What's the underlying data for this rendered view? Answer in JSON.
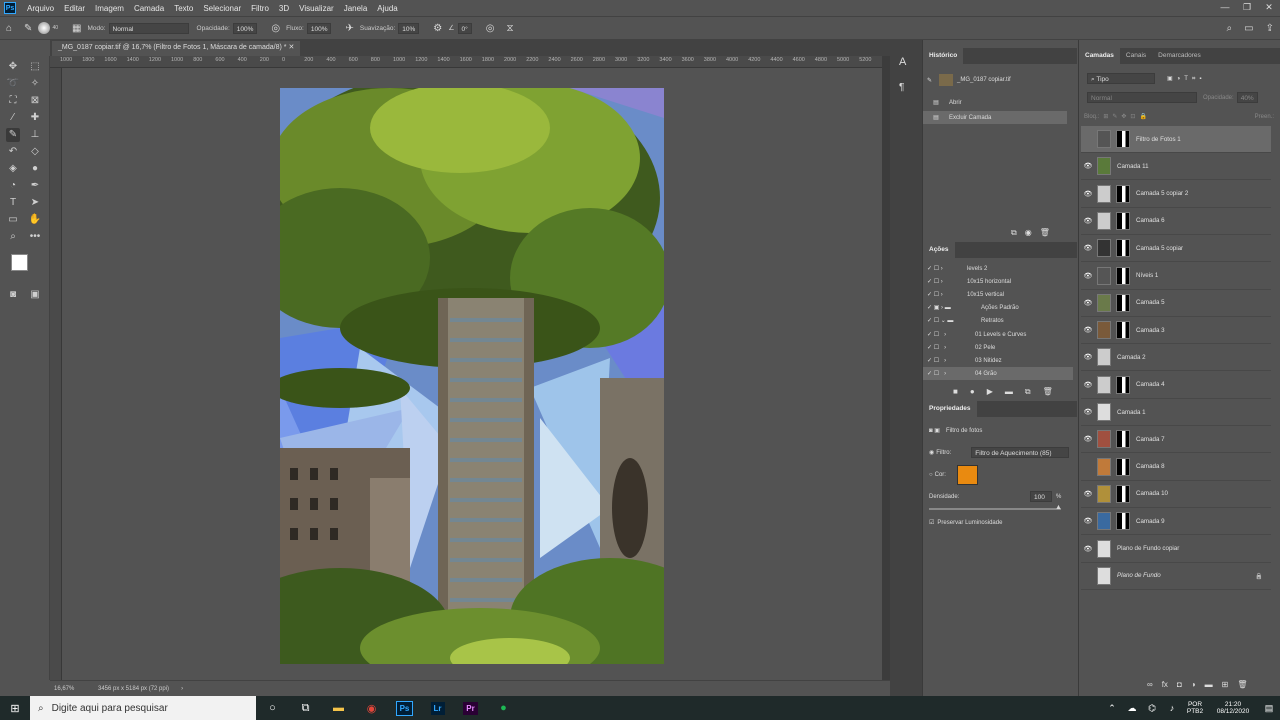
{
  "menubar": {
    "logo": "Ps",
    "items": [
      "Arquivo",
      "Editar",
      "Imagem",
      "Camada",
      "Texto",
      "Selecionar",
      "Filtro",
      "3D",
      "Visualizar",
      "Janela",
      "Ajuda"
    ],
    "win_controls": [
      "—",
      "❐",
      "✕"
    ]
  },
  "options": {
    "brush_size": "40",
    "mode_label": "Modo:",
    "mode_value": "Normal",
    "opacity_label": "Opacidade:",
    "opacity_value": "100%",
    "flow_label": "Fluxo:",
    "flow_value": "100%",
    "smoothing_label": "Suavização:",
    "smoothing_value": "10%",
    "angle_value": "0°"
  },
  "document": {
    "tab_title": "_MG_0187 copiar.tif @ 16,7% (Filtro de Fotos 1, Máscara de camada/8) *",
    "zoom": "16,67%",
    "dimensions": "3456 px x 5184 px (72 ppi)",
    "ruler_labels": [
      "1000",
      "1800",
      "1600",
      "1400",
      "1200",
      "1000",
      "800",
      "600",
      "400",
      "200",
      "0",
      "200",
      "400",
      "600",
      "800",
      "1000",
      "1200",
      "1400",
      "1600",
      "1800",
      "2000",
      "2200",
      "2400",
      "2600",
      "2800",
      "3000",
      "3200",
      "3400",
      "3600",
      "3800",
      "4000",
      "4200",
      "4400",
      "4600",
      "4800",
      "5000",
      "5200"
    ]
  },
  "history": {
    "title": "Histórico",
    "snapshot": "_MG_0187 copiar.tif",
    "items": [
      "Abrir",
      "Excluir Camada"
    ]
  },
  "actions": {
    "title": "Ações",
    "items": [
      "levels 2",
      "10x15 horizontal",
      "10x15 vertical",
      "Ações Padrão",
      "Retratos",
      "01 Levels e Curves",
      "02 Pele",
      "03 Nitidez",
      "04 Grão"
    ]
  },
  "properties": {
    "title": "Propriedades",
    "subtitle": "Filtro de fotos",
    "filter_label": "Filtro:",
    "filter_value": "Filtro de Aquecimento (85)",
    "color_label": "Cor:",
    "color_hex": "#e98a10",
    "density_label": "Densidade:",
    "density_value": "100",
    "density_unit": "%",
    "preserve_label": "Preservar Luminosidade"
  },
  "layers_panel": {
    "tabs": [
      "Camadas",
      "Canais",
      "Demarcadores"
    ],
    "kind_filter": "Tipo",
    "blend_mode": "Normal",
    "opacity_label": "Opacidade:",
    "opacity_value": "40%",
    "lock_label": "Bloq.:",
    "fill_label": "Preen.:",
    "layers": [
      {
        "name": "Filtro de Fotos 1",
        "visible": false,
        "thumb": "#555",
        "mask": true,
        "selected": true
      },
      {
        "name": "Camada 11",
        "visible": true,
        "thumb": "#5a7a3a",
        "mask": false
      },
      {
        "name": "Camada 5 copiar 2",
        "visible": true,
        "thumb": "#ccc",
        "mask": true
      },
      {
        "name": "Camada 6",
        "visible": true,
        "thumb": "#ccc",
        "mask": true
      },
      {
        "name": "Camada 5 copiar",
        "visible": true,
        "thumb": "#333",
        "mask": true
      },
      {
        "name": "Níveis 1",
        "visible": true,
        "thumb": "#555",
        "mask": true
      },
      {
        "name": "Camada 5",
        "visible": true,
        "thumb": "#6a7a4a",
        "mask": true
      },
      {
        "name": "Camada 3",
        "visible": true,
        "thumb": "#7a5a3a",
        "mask": true
      },
      {
        "name": "Camada 2",
        "visible": true,
        "thumb": "#ccc",
        "mask": false
      },
      {
        "name": "Camada 4",
        "visible": true,
        "thumb": "#ccc",
        "mask": true
      },
      {
        "name": "Camada 1",
        "visible": true,
        "thumb": "#ddd",
        "mask": false
      },
      {
        "name": "Camada 7",
        "visible": true,
        "thumb": "#a05040",
        "mask": true
      },
      {
        "name": "Camada 8",
        "visible": false,
        "thumb": "#c07a3a",
        "mask": true
      },
      {
        "name": "Camada 10",
        "visible": true,
        "thumb": "#b0903a",
        "mask": true
      },
      {
        "name": "Camada 9",
        "visible": true,
        "thumb": "#3a6aa0",
        "mask": true
      },
      {
        "name": "Plano de Fundo copiar",
        "visible": true,
        "thumb": "#ddd",
        "mask": false
      },
      {
        "name": "Plano de Fundo",
        "visible": false,
        "thumb": "#ddd",
        "mask": false,
        "locked": true
      }
    ]
  },
  "taskbar": {
    "search_placeholder": "Digite aqui para pesquisar",
    "lang": "POR",
    "lang2": "PTB2",
    "time": "21:20",
    "date": "08/12/2020"
  }
}
